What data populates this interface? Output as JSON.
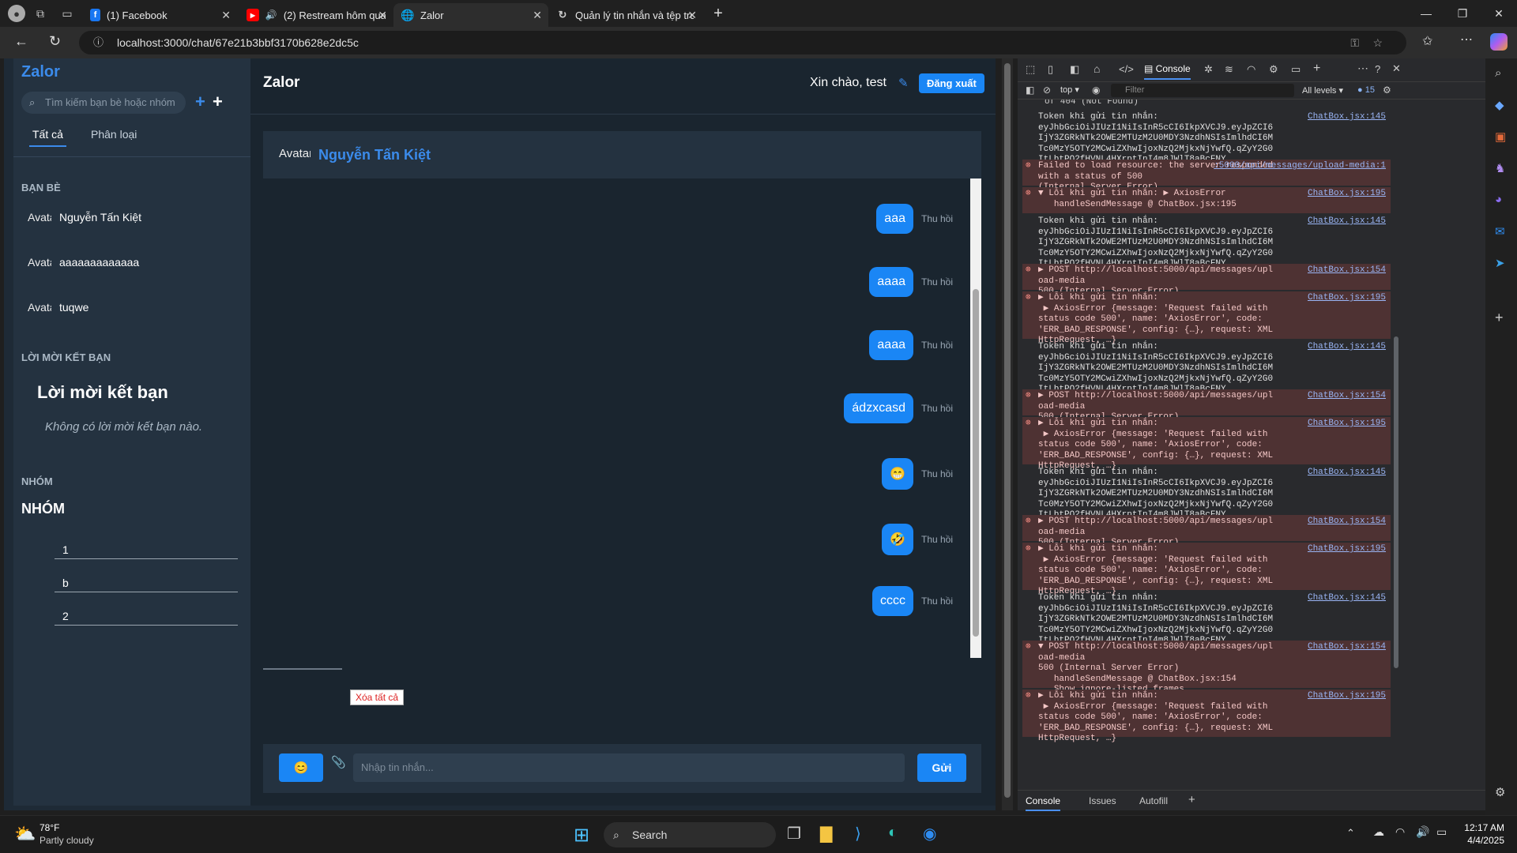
{
  "browser": {
    "tabs": [
      {
        "title": "(1) Facebook"
      },
      {
        "title": "(2) Restream hôm qua..........."
      },
      {
        "title": "Zalor"
      },
      {
        "title": "Quản lý tin nhắn và tệp truyền th"
      }
    ],
    "url": "localhost:3000/chat/67e21b3bbf3170b628e2dc5c"
  },
  "sidebar": {
    "title": "Zalor",
    "search_placeholder": "Tìm kiếm bạn bè hoặc nhóm",
    "tabs": [
      "Tất cả",
      "Phân loại"
    ],
    "friends_heading": "BẠN BÈ",
    "friends": [
      {
        "name": "Nguyễn Tấn Kiệt",
        "avatar_alt": "Avatar"
      },
      {
        "name": "aaaaaaaaaaaaa",
        "avatar_alt": "Avatar"
      },
      {
        "name": "tuqwe",
        "avatar_alt": "Avatar"
      }
    ],
    "requests_heading": "LỜI MỜI KẾT BẠN",
    "requests_title": "Lời mời kết bạn",
    "requests_empty": "Không có lời mời kết bạn nào.",
    "groups_heading": "NHÓM",
    "groups_title": "NHÓM",
    "groups": [
      "1",
      "b",
      "2"
    ]
  },
  "header": {
    "title": "Zalor",
    "greeting": "Xin chào, test",
    "logout": "Đăng xuất"
  },
  "chat": {
    "contact_name": "Nguyễn Tấn Kiệt",
    "avatar_alt": "Avatar",
    "recall_label": "Thu hồi",
    "messages": [
      "aaa",
      "aaaa",
      "aaaa",
      "ádzxcasd",
      "😁",
      "🤣",
      "cccc"
    ],
    "clear_all": "Xóa tất cả",
    "emoji_button": "😊",
    "input_placeholder": "Nhập tin nhắn...",
    "send": "Gửi"
  },
  "devtools": {
    "tab_console": "Console",
    "context": "top",
    "filter_placeholder": "Filter",
    "levels": "All levels",
    "issue_count": "15",
    "top_fragment": "of 404 (Not Found)",
    "logs": [
      {
        "kind": "log",
        "text": "Token khi gửi tin nhắn:\neyJhbGciOiJIUzI1NiIsInR5cCI6IkpXVCJ9.eyJpZCI6IjY3ZGRkNTk2OWE2MTUzM2U0MDY3NzdhNSIsImlhdCI6MTc0MzY5OTY2MCwiZXhwIjoxNzQ2MjkxNjYwfQ.qZyY2G0ItLbtPQ2fHVNL4HXrptInI4m8JWlT8aBcFNY",
        "src": "ChatBox.jsx:145"
      },
      {
        "kind": "err",
        "text": "Failed to load resource: the server responded with a status of 500\n(Internal Server Error)",
        "src": ":5000/api/messages/upload-media:1"
      },
      {
        "kind": "err",
        "text": "▼ Lỗi khi gửi tin nhắn: ▶ AxiosError\n   handleSendMessage @ ChatBox.jsx:195",
        "src": "ChatBox.jsx:195"
      },
      {
        "kind": "log",
        "text": "Token khi gửi tin nhắn:\neyJhbGciOiJIUzI1NiIsInR5cCI6IkpXVCJ9.eyJpZCI6IjY3ZGRkNTk2OWE2MTUzM2U0MDY3NzdhNSIsImlhdCI6MTc0MzY5OTY2MCwiZXhwIjoxNzQ2MjkxNjYwfQ.qZyY2G0ItLbtPQ2fHVNL4HXrptInI4m8JWlT8aBcFNY",
        "src": "ChatBox.jsx:145"
      },
      {
        "kind": "err",
        "text": "▶ POST http://localhost:5000/api/messages/upload-media\n500 (Internal Server Error)",
        "src": "ChatBox.jsx:154"
      },
      {
        "kind": "err",
        "text": "▶ Lỗi khi gửi tin nhắn:\n ▶ AxiosError {message: 'Request failed with status code 500', name: 'AxiosError', code: 'ERR_BAD_RESPONSE', config: {…}, request: XMLHttpRequest, …}",
        "src": "ChatBox.jsx:195"
      },
      {
        "kind": "log",
        "text": "Token khi gửi tin nhắn:\neyJhbGciOiJIUzI1NiIsInR5cCI6IkpXVCJ9.eyJpZCI6IjY3ZGRkNTk2OWE2MTUzM2U0MDY3NzdhNSIsImlhdCI6MTc0MzY5OTY2MCwiZXhwIjoxNzQ2MjkxNjYwfQ.qZyY2G0ItLbtPQ2fHVNL4HXrptInI4m8JWlT8aBcFNY",
        "src": "ChatBox.jsx:145"
      },
      {
        "kind": "err",
        "text": "▶ POST http://localhost:5000/api/messages/upload-media\n500 (Internal Server Error)",
        "src": "ChatBox.jsx:154"
      },
      {
        "kind": "err",
        "text": "▶ Lỗi khi gửi tin nhắn:\n ▶ AxiosError {message: 'Request failed with status code 500', name: 'AxiosError', code: 'ERR_BAD_RESPONSE', config: {…}, request: XMLHttpRequest, …}",
        "src": "ChatBox.jsx:195"
      },
      {
        "kind": "log",
        "text": "Token khi gửi tin nhắn:\neyJhbGciOiJIUzI1NiIsInR5cCI6IkpXVCJ9.eyJpZCI6IjY3ZGRkNTk2OWE2MTUzM2U0MDY3NzdhNSIsImlhdCI6MTc0MzY5OTY2MCwiZXhwIjoxNzQ2MjkxNjYwfQ.qZyY2G0ItLbtPQ2fHVNL4HXrptInI4m8JWlT8aBcFNY",
        "src": "ChatBox.jsx:145"
      },
      {
        "kind": "err",
        "text": "▶ POST http://localhost:5000/api/messages/upload-media\n500 (Internal Server Error)",
        "src": "ChatBox.jsx:154"
      },
      {
        "kind": "err",
        "text": "▶ Lỗi khi gửi tin nhắn:\n ▶ AxiosError {message: 'Request failed with status code 500', name: 'AxiosError', code: 'ERR_BAD_RESPONSE', config: {…}, request: XMLHttpRequest, …}",
        "src": "ChatBox.jsx:195"
      },
      {
        "kind": "log",
        "text": "Token khi gửi tin nhắn:\neyJhbGciOiJIUzI1NiIsInR5cCI6IkpXVCJ9.eyJpZCI6IjY3ZGRkNTk2OWE2MTUzM2U0MDY3NzdhNSIsImlhdCI6MTc0MzY5OTY2MCwiZXhwIjoxNzQ2MjkxNjYwfQ.qZyY2G0ItLbtPQ2fHVNL4HXrptInI4m8JWlT8aBcFNY",
        "src": "ChatBox.jsx:145"
      },
      {
        "kind": "err",
        "text": "▼ POST http://localhost:5000/api/messages/upload-media\n500 (Internal Server Error)\n   handleSendMessage @ ChatBox.jsx:154\n   Show ignore-listed frames",
        "src": "ChatBox.jsx:154"
      },
      {
        "kind": "err",
        "text": "▶ Lỗi khi gửi tin nhắn:\n ▶ AxiosError {message: 'Request failed with status code 500', name: 'AxiosError', code: 'ERR_BAD_RESPONSE', config: {…}, request: XMLHttpRequest, …}",
        "src": "ChatBox.jsx:195"
      }
    ],
    "bottom_tabs": [
      "Console",
      "Issues",
      "Autofill"
    ]
  },
  "taskbar": {
    "temp": "78°F",
    "weather": "Partly cloudy",
    "search": "Search",
    "time": "12:17 AM",
    "date": "4/4/2025"
  },
  "colors": {
    "accent": "#1a86f5",
    "brand": "#3b8beb",
    "error_bg": "#4e3233"
  }
}
